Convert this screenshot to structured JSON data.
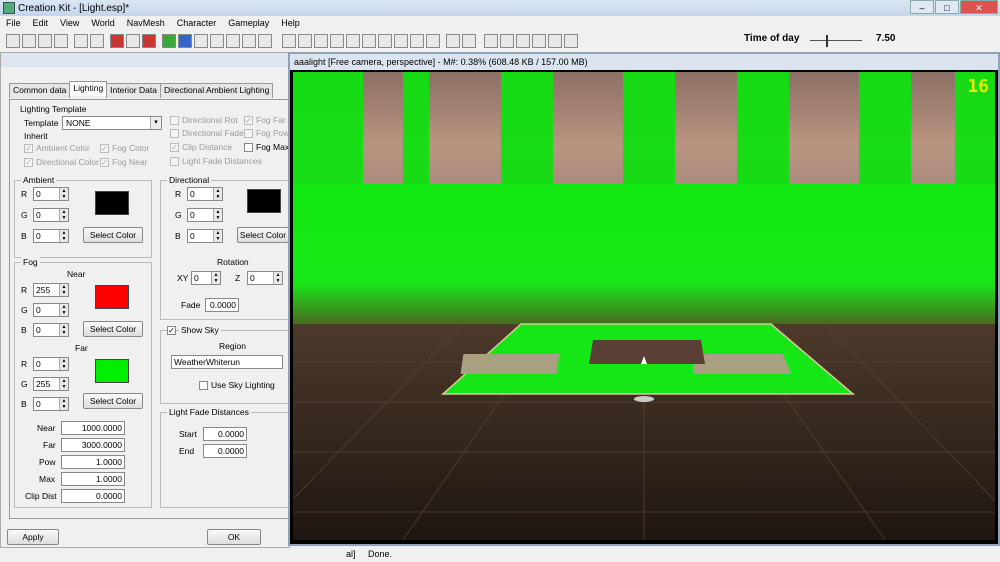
{
  "window": {
    "title": "Creation Kit - [Light.esp]*",
    "minimize": "–",
    "maximize": "□",
    "close": "✕"
  },
  "menu": [
    "File",
    "Edit",
    "View",
    "World",
    "NavMesh",
    "Character",
    "Gameplay",
    "Help"
  ],
  "toolbar": {
    "time_of_day_label": "Time of day",
    "time_of_day_value": "7.50",
    "time_of_day_level": 0.31
  },
  "dialog": {
    "tabs": [
      "Common data",
      "Lighting",
      "Interior Data",
      "Directional Ambient Lighting"
    ],
    "lighting_template": {
      "group_label": "Lighting Template",
      "template_label": "Template",
      "template_value": "NONE",
      "inherit_label": "Inherit",
      "checks": [
        {
          "label": "Ambient Color",
          "checked": true,
          "enabled": false
        },
        {
          "label": "Fog Color",
          "checked": true,
          "enabled": false
        },
        {
          "label": "Directional Color",
          "checked": true,
          "enabled": false
        },
        {
          "label": "Fog Near",
          "checked": true,
          "enabled": false
        },
        {
          "label": "Directional Rot",
          "checked": false,
          "enabled": false
        },
        {
          "label": "Directional Fade",
          "checked": false,
          "enabled": false
        },
        {
          "label": "Clip Distance",
          "checked": true,
          "enabled": false
        },
        {
          "label": "Light Fade Distances",
          "checked": false,
          "enabled": false
        },
        {
          "label": "Fog Far",
          "checked": true,
          "enabled": false
        },
        {
          "label": "Fog Pow",
          "checked": false,
          "enabled": false
        },
        {
          "label": "Fog Max",
          "checked": false,
          "enabled": true
        }
      ]
    },
    "ambient": {
      "label": "Ambient",
      "r": "0",
      "g": "0",
      "b": "0",
      "color": "#000000",
      "select_color": "Select Color"
    },
    "directional": {
      "label": "Directional",
      "r": "0",
      "g": "0",
      "b": "0",
      "color": "#000000",
      "select_color": "Select Color",
      "rotation_label": "Rotation",
      "xy_label": "XY",
      "xy": "0",
      "z_label": "Z",
      "z": "0",
      "fade_label": "Fade",
      "fade": "0.0000"
    },
    "fog": {
      "label": "Fog",
      "near_label": "Near",
      "near_r": "255",
      "near_g": "0",
      "near_b": "0",
      "near_color": "#ff0000",
      "far_label": "Far",
      "far_r": "0",
      "far_g": "255",
      "far_b": "0",
      "far_color": "#00ee00",
      "select_color": "Select Color",
      "near_dist_label": "Near",
      "near_dist": "1000.0000",
      "far_dist_label": "Far",
      "far_dist": "3000.0000",
      "pow_label": "Pow",
      "pow": "1.0000",
      "max_label": "Max",
      "max": "1.0000",
      "clip_label": "Clip Dist",
      "clip": "0.0000"
    },
    "sky": {
      "show_sky_label": "Show Sky",
      "show_sky": true,
      "region_label": "Region",
      "region": "WeatherWhiterun",
      "use_sky_label": "Use Sky Lighting",
      "use_sky": false
    },
    "light_fade": {
      "label": "Light Fade Distances",
      "start_label": "Start",
      "start": "0.0000",
      "end_label": "End",
      "end": "0.0000"
    },
    "rgb": {
      "r": "R",
      "g": "G",
      "b": "B"
    },
    "apply": "Apply",
    "ok": "OK"
  },
  "viewport": {
    "title": "aaalight [Free camera, perspective] - M#: 0.38% (608.48 KB / 157.00 MB)",
    "fps": "16"
  },
  "status": {
    "left": "al]",
    "text": "Done."
  }
}
